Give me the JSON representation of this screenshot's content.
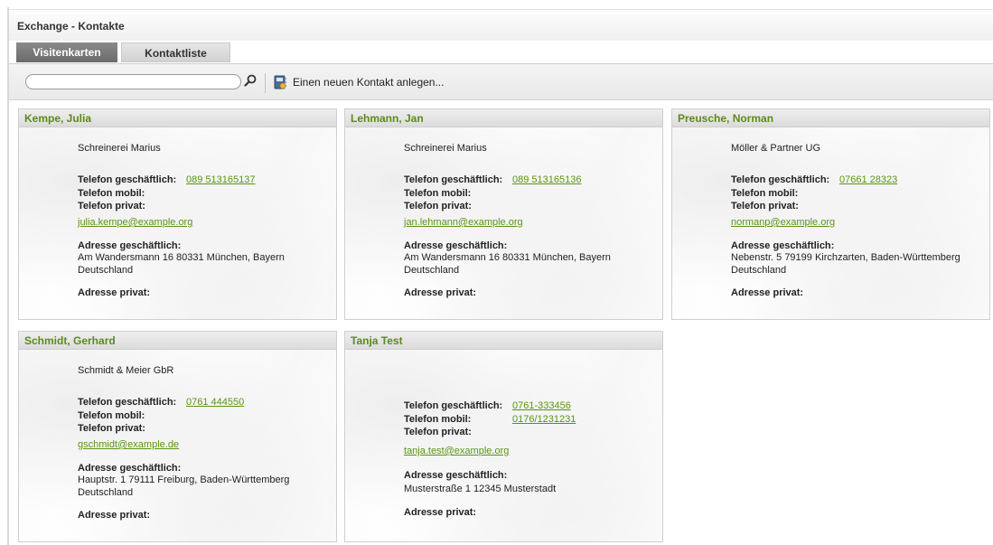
{
  "window": {
    "title": "Exchange - Kontakte"
  },
  "tabs": [
    {
      "label": "Visitenkarten",
      "active": true
    },
    {
      "label": "Kontaktliste",
      "active": false
    }
  ],
  "toolbar": {
    "search_value": "",
    "search_placeholder": "",
    "new_contact_label": "Einen neuen Kontakt anlegen..."
  },
  "labels": {
    "phone_business": "Telefon geschäftlich:",
    "phone_mobile": "Telefon mobil:",
    "phone_private": "Telefon privat:",
    "address_business": "Adresse geschäftlich:",
    "address_private": "Adresse privat:"
  },
  "contacts": [
    {
      "name": "Kempe, Julia",
      "company": "Schreinerei Marius",
      "phone_business": "089 513165137",
      "phone_mobile": "",
      "email": "julia.kempe@example.org",
      "address_line1": "Am Wandersmann 16 80331 München, Bayern",
      "address_line2": "Deutschland"
    },
    {
      "name": "Lehmann, Jan",
      "company": "Schreinerei Marius",
      "phone_business": "089 513165136",
      "phone_mobile": "",
      "email": "jan.lehmann@example.org",
      "address_line1": "Am Wandersmann 16 80331 München, Bayern",
      "address_line2": "Deutschland"
    },
    {
      "name": "Preusche, Norman",
      "company": "Möller & Partner UG",
      "phone_business": "07661 28323",
      "phone_mobile": "",
      "email": "normanp@example.org",
      "address_line1": "Nebenstr. 5 79199 Kirchzarten, Baden-Württemberg",
      "address_line2": "Deutschland"
    },
    {
      "name": "Schmidt, Gerhard",
      "company": "Schmidt & Meier GbR",
      "phone_business": "0761 444550",
      "phone_mobile": "",
      "email": "gschmidt@example.de",
      "address_line1": "Hauptstr. 1 79111 Freiburg, Baden-Württemberg",
      "address_line2": "Deutschland"
    },
    {
      "name": "Tanja Test",
      "company": "",
      "phone_business": "0761-333456",
      "phone_mobile": "0176/1231231",
      "email": "tanja.test@example.org",
      "address_line1": "Musterstraße 1 12345 Musterstadt",
      "address_line2": ""
    }
  ]
}
